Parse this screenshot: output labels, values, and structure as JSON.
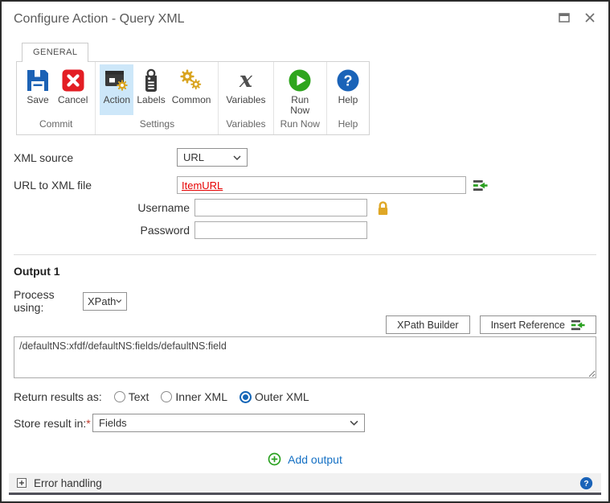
{
  "colors": {
    "accent_link": "#1470c4",
    "ribbon_selected_bg": "#cde7f9",
    "save_blue": "#1c62b5",
    "cancel_red": "#e31e24",
    "gear_gold": "#d9a420",
    "run_green": "#2ea51d",
    "help_blue": "#1a63b8",
    "reference_text_red": "#e60000",
    "radio_blue": "#1566b7",
    "lock_gold": "#dfa726",
    "insert_green": "#2ba121"
  },
  "window": {
    "title": "Configure Action - Query XML"
  },
  "tabs": [
    {
      "label": "GENERAL"
    }
  ],
  "ribbon": {
    "groups": [
      {
        "label": "Commit",
        "buttons": [
          {
            "label": "Save"
          },
          {
            "label": "Cancel"
          }
        ]
      },
      {
        "label": "Settings",
        "buttons": [
          {
            "label": "Action",
            "selected": true
          },
          {
            "label": "Labels"
          },
          {
            "label": "Common"
          }
        ]
      },
      {
        "label": "Variables",
        "buttons": [
          {
            "label": "Variables"
          }
        ]
      },
      {
        "label": "Run Now",
        "buttons": [
          {
            "label": "Run Now"
          }
        ]
      },
      {
        "label": "Help",
        "buttons": [
          {
            "label": "Help"
          }
        ]
      }
    ]
  },
  "form": {
    "xml_source": {
      "label": "XML source",
      "value": "URL"
    },
    "url_field": {
      "label": "URL to XML file",
      "value": "ItemURL"
    },
    "username": {
      "label": "Username",
      "value": ""
    },
    "password": {
      "label": "Password",
      "value": ""
    }
  },
  "output": {
    "heading": "Output 1",
    "process_using": {
      "label": "Process using:",
      "value": "XPath"
    },
    "buttons": {
      "xpath_builder": "XPath Builder",
      "insert_reference": "Insert Reference"
    },
    "xpath_expression": "/defaultNS:xfdf/defaultNS:fields/defaultNS:field",
    "return_results": {
      "label": "Return results as:",
      "options": [
        {
          "label": "Text",
          "selected": false
        },
        {
          "label": "Inner XML",
          "selected": false
        },
        {
          "label": "Outer XML",
          "selected": true
        }
      ]
    },
    "store_result": {
      "label": "Store result in:",
      "required_mark": "*",
      "value": "Fields"
    },
    "add_output_label": "Add output"
  },
  "error_handling": {
    "label": "Error handling"
  }
}
